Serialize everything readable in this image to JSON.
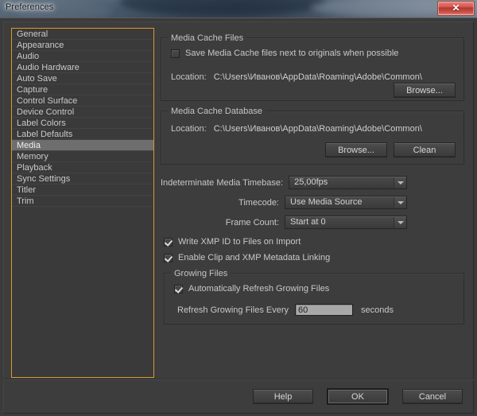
{
  "window": {
    "title": "Preferences",
    "close_label": "✕",
    "close_icon": "close-icon"
  },
  "sidebar": {
    "selected": "Media",
    "items": [
      {
        "label": "General"
      },
      {
        "label": "Appearance"
      },
      {
        "label": "Audio"
      },
      {
        "label": "Audio Hardware"
      },
      {
        "label": "Auto Save"
      },
      {
        "label": "Capture"
      },
      {
        "label": "Control Surface"
      },
      {
        "label": "Device Control"
      },
      {
        "label": "Label Colors"
      },
      {
        "label": "Label Defaults"
      },
      {
        "label": "Media"
      },
      {
        "label": "Memory"
      },
      {
        "label": "Playback"
      },
      {
        "label": "Sync Settings"
      },
      {
        "label": "Titler"
      },
      {
        "label": "Trim"
      }
    ]
  },
  "media_cache_files": {
    "group_title": "Media Cache Files",
    "save_next_to_originals": {
      "label": "Save Media Cache files next to originals when possible",
      "checked": false
    },
    "location_label": "Location:",
    "location_path": "C:\\Users\\Иванов\\AppData\\Roaming\\Adobe\\Common\\",
    "browse_label": "Browse..."
  },
  "media_cache_database": {
    "group_title": "Media Cache Database",
    "location_label": "Location:",
    "location_path": "C:\\Users\\Иванов\\AppData\\Roaming\\Adobe\\Common\\",
    "browse_label": "Browse...",
    "clean_label": "Clean"
  },
  "fields": {
    "timebase": {
      "label": "Indeterminate Media Timebase:",
      "value": "25,00fps"
    },
    "timecode": {
      "label": "Timecode:",
      "value": "Use Media Source"
    },
    "frame_count": {
      "label": "Frame Count:",
      "value": "Start at 0"
    }
  },
  "options": {
    "write_xmp": {
      "label": "Write XMP ID to Files on Import",
      "checked": true
    },
    "enable_clip_xmp": {
      "label": "Enable Clip and XMP Metadata Linking",
      "checked": true
    }
  },
  "growing_files": {
    "group_title": "Growing Files",
    "auto_refresh": {
      "label": "Automatically Refresh Growing Files",
      "checked": true
    },
    "refresh_every_label": "Refresh Growing Files Every",
    "refresh_value": "60",
    "refresh_placeholder": "60",
    "seconds_label": "seconds"
  },
  "footer": {
    "help_label": "Help",
    "ok_label": "OK",
    "cancel_label": "Cancel"
  },
  "colors": {
    "focus_border": "#d79a2b",
    "dialog_bg": "#3d3d3d",
    "selection": "#6e6e6e",
    "close_red": "#c9564e"
  }
}
